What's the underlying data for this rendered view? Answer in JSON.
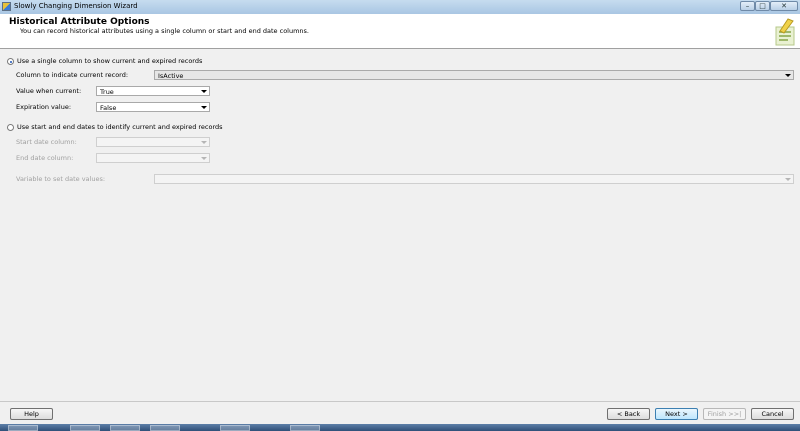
{
  "window": {
    "title": "Slowly Changing Dimension Wizard",
    "buttons": {
      "minimize": "–",
      "maximize": "□",
      "close": "✕"
    }
  },
  "header": {
    "title": "Historical Attribute Options",
    "description": "You can record historical attributes using a single column or start and end date columns."
  },
  "options": {
    "single_column": {
      "label": "Use a single column to show current and expired records",
      "selected": true,
      "column_label": "Column to indicate current record:",
      "column_value": "IsActive",
      "current_label": "Value when current:",
      "current_value": "True",
      "expired_label": "Expiration value:",
      "expired_value": "False"
    },
    "date_columns": {
      "label": "Use start and end dates to identify current and expired records",
      "selected": false,
      "start_label": "Start date column:",
      "start_value": "",
      "end_label": "End date column:",
      "end_value": "",
      "variable_label": "Variable to set date values:",
      "variable_value": ""
    }
  },
  "footer": {
    "help": "Help",
    "back": "< Back",
    "next": "Next >",
    "finish": "Finish >>|",
    "cancel": "Cancel"
  },
  "colors": {
    "accent": "#1e56b8",
    "titlebar": "#b9d1ea",
    "background": "#f0f0f0"
  }
}
